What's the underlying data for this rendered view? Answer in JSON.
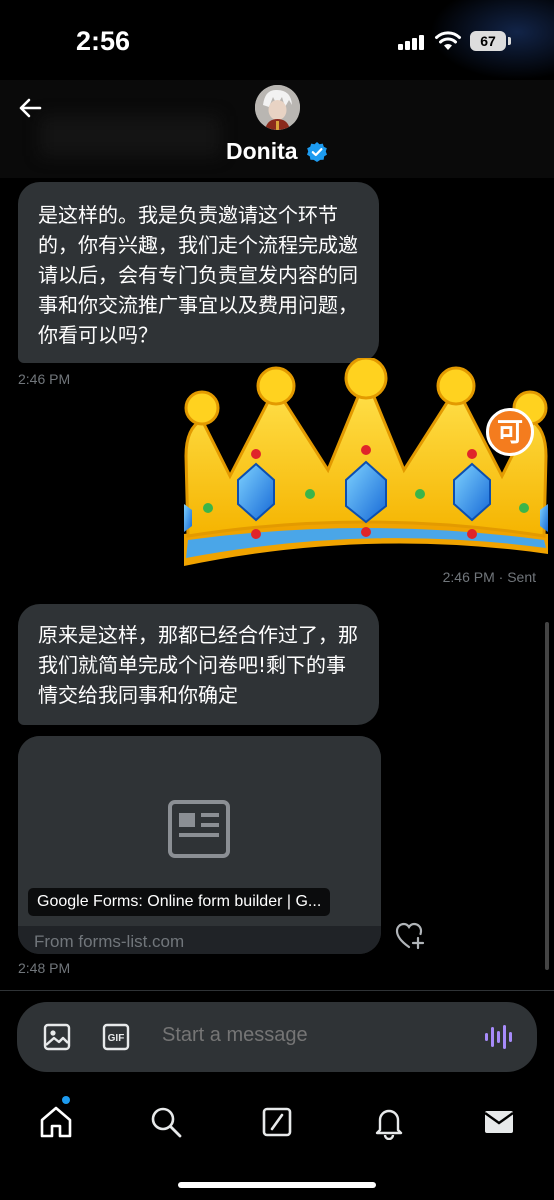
{
  "status_bar": {
    "time": "2:56",
    "battery": "67"
  },
  "header": {
    "name": "Donita",
    "back_icon": "back-arrow-icon",
    "verified_icon": "verified-badge-icon"
  },
  "messages": [
    {
      "text": "是这样的。我是负责邀请这个环节的，你有兴趣，我们走个流程完成邀请以后，会有专门负责宣发内容的同事和你交流推广事宜以及费用问题，你看可以吗？",
      "time": "2:46 PM"
    },
    {
      "type": "sticker",
      "sticker": "crown",
      "time": "2:46 PM · Sent",
      "peek_char": "可"
    },
    {
      "text": "原来是这样，那都已经合作过了，那我们就简单完成个问卷吧!剩下的事情交给我同事和你确定"
    },
    {
      "type": "link_card",
      "title": "Google Forms: Online form builder | G...",
      "from": "From forms-list.com",
      "time": "2:48 PM"
    }
  ],
  "composer": {
    "placeholder": "Start a message",
    "gif_label": "GIF"
  },
  "tabs": [
    "home-icon",
    "search-icon",
    "grok-icon",
    "notifications-icon",
    "messages-icon"
  ],
  "colors": {
    "accent": "#1d9bf0",
    "bubble": "#2f3336",
    "voice": "#a78bfa"
  }
}
